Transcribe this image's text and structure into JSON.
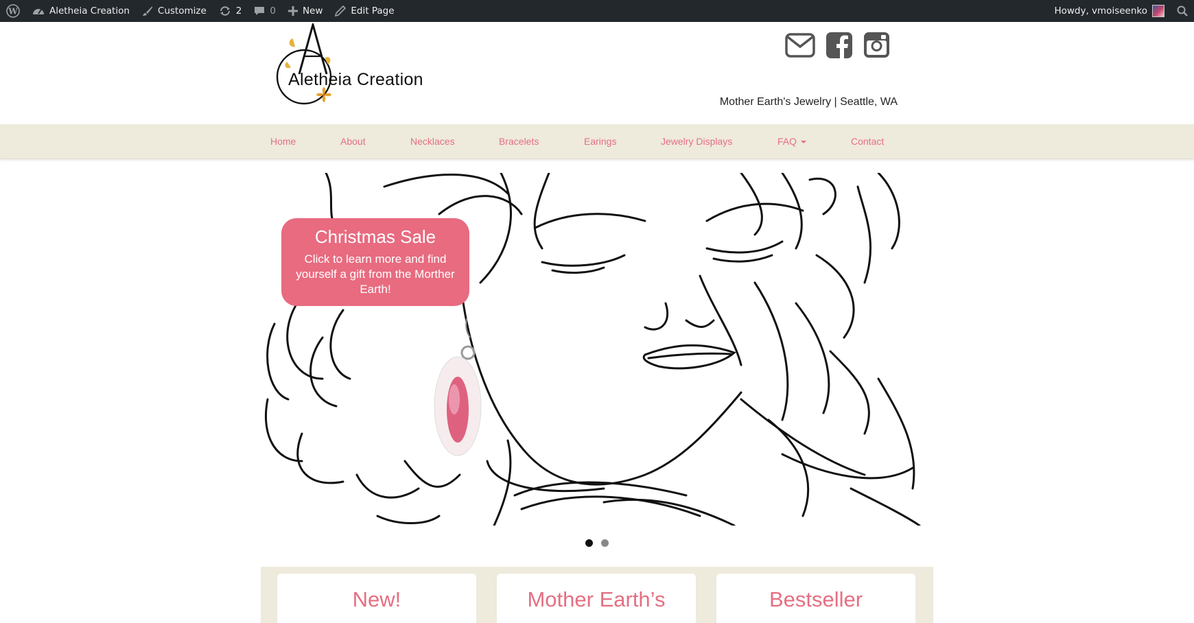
{
  "admin_bar": {
    "site_name": "Aletheia Creation",
    "customize": "Customize",
    "updates_count": "2",
    "comments_count": "0",
    "new_label": "New",
    "edit_page": "Edit Page",
    "howdy": "Howdy, vmoiseenko"
  },
  "header": {
    "logo_text": "Aletheia Creation",
    "tagline": "Mother Earth's Jewelry | Seattle, WA"
  },
  "nav": {
    "items": [
      "Home",
      "About",
      "Necklaces",
      "Bracelets",
      "Earings",
      "Jewelry Displays",
      "FAQ",
      "Contact"
    ]
  },
  "slider": {
    "title": "Christmas Sale",
    "text": "Click to learn more and find yourself a gift from the Morther Earth!",
    "slide_count": 2,
    "active_index": 0
  },
  "featured": {
    "cards": [
      "New!",
      "Mother Earth’s",
      "Bestseller"
    ]
  },
  "colors": {
    "accent": "#e86b80",
    "nav_bg": "#eeeadc",
    "admin_bg": "#23282d"
  }
}
